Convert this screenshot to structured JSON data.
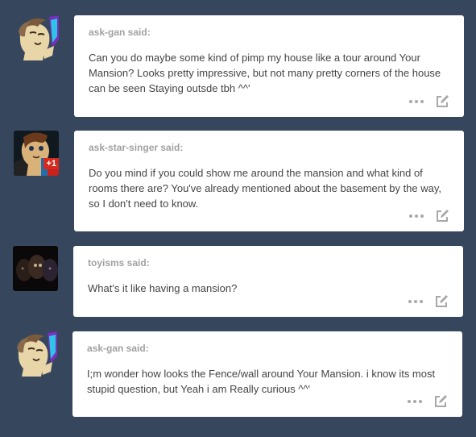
{
  "posts": [
    {
      "asker": "ask-gan said:",
      "body": "Can you do maybe some kind of pimp my house like a tour around Your Mansion? Looks pretty impressive, but not many pretty corners of the house can be seen Staying outsde tbh ^^'",
      "avatar": "pony-avatar"
    },
    {
      "asker": "ask-star-singer said:",
      "body": "Do you mind if you could show me around the mansion and what kind of rooms there are? You've already mentioned about the basement by the way, so I don't need to know.",
      "avatar": "pony-avatar",
      "badge": "+1"
    },
    {
      "asker": "toyisms said:",
      "body": "What's it like having a mansion?",
      "avatar": "dark-animatronic-avatar"
    },
    {
      "asker": "ask-gan said:",
      "body": "I;m wonder how looks the Fence/wall around Your Mansion. i know its most stupid question, but Yeah i am Really curious ^^'",
      "avatar": "pony-avatar"
    }
  ],
  "colors": {
    "background": "#36465d",
    "card": "#ffffff",
    "asker_text": "#a1a1a1",
    "body_text": "#444444",
    "icon": "#a8a8a8"
  },
  "icons": {
    "more": "more-dots-icon",
    "edit": "edit-pencil-icon"
  }
}
